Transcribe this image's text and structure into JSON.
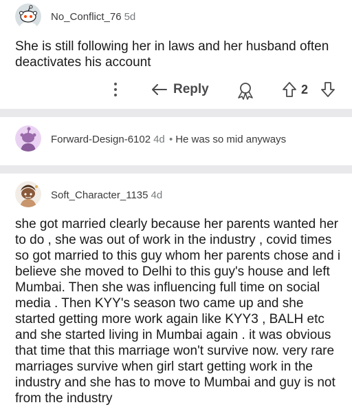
{
  "comments": [
    {
      "username": "No_Conflict_76",
      "age": "5d",
      "body": "She is still following her in laws and her husband often deactivates his account",
      "actions": {
        "reply_label": "Reply",
        "score": "2"
      }
    },
    {
      "username": "Forward-Design-6102",
      "age": "4d",
      "separator": "•",
      "body": "He was so mid anyways"
    },
    {
      "username": "Soft_Character_1135",
      "age": "4d",
      "body": "she got married clearly because her parents wanted her to do , she was out of work in the industry , covid times so got married to this guy whom her parents chose and i believe she moved to Delhi to this guy's house and left Mumbai. Then she was influencing full time on social media . Then KYY's season two came up and she started getting more work again like KYY3 , BALH etc and she started living in Mumbai again . it was obvious that time that this marriage won't survive now. very rare marriages survive when girl start getting work in the industry and she has to move to Mumbai and guy is not from the industry"
    }
  ],
  "colors": {
    "separator": "#e9e9eb",
    "username": "#3a3a3c",
    "meta": "#787c7e",
    "avatar1_bg": "#d7dfe2",
    "avatar2_bg": "#ead3f2",
    "avatar3_bg": "#f2ece6"
  },
  "icons": [
    "snoo-avatar-icon",
    "more-options-icon",
    "reply-arrow-icon",
    "award-icon",
    "upvote-arrow-icon",
    "downvote-arrow-icon"
  ]
}
